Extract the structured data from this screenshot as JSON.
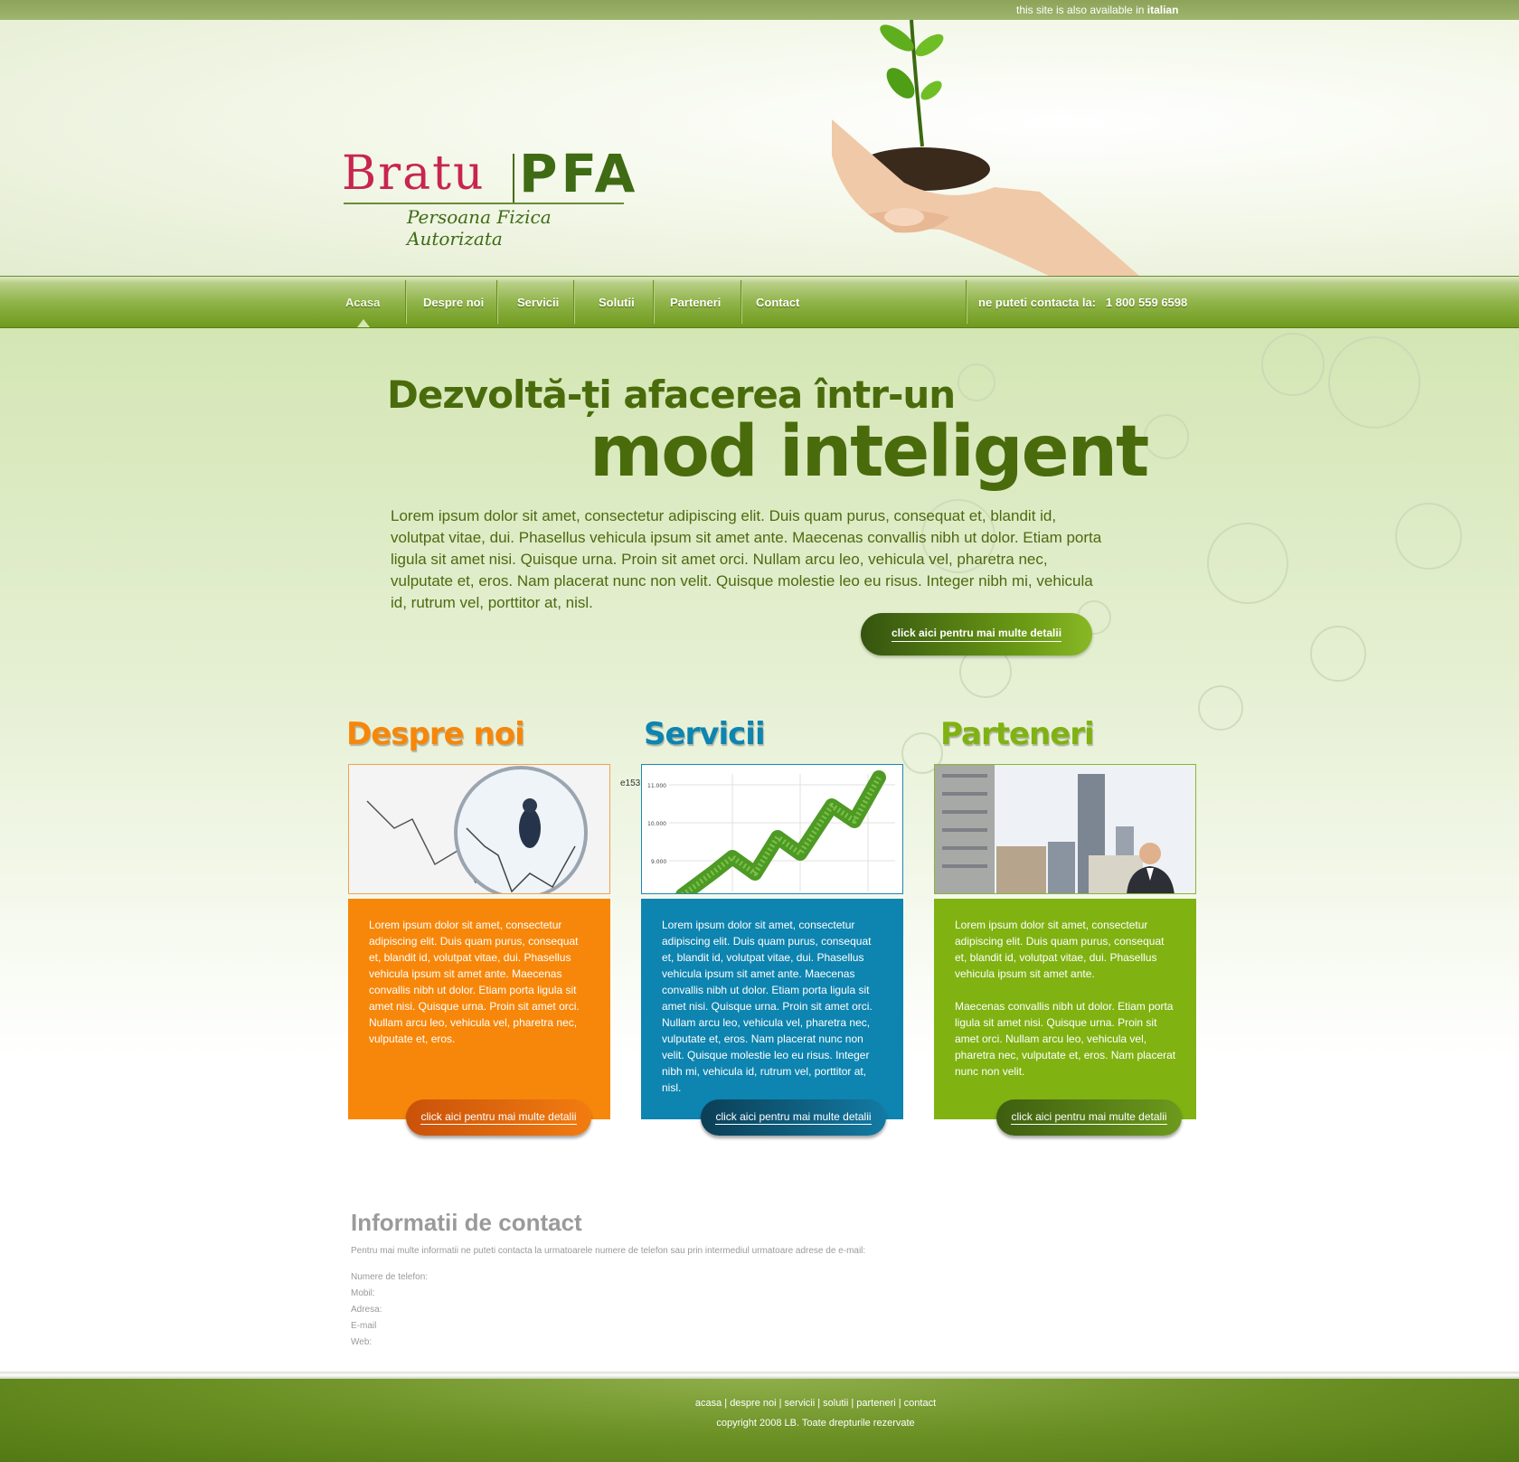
{
  "topbar": {
    "lang_prefix": "this site is also available in",
    "lang_link": "italian"
  },
  "logo": {
    "name": "Bratu",
    "suffix": "PFA",
    "tagline": "Persoana Fizica Autorizata"
  },
  "nav": {
    "items": [
      {
        "label": "Acasa",
        "active": true
      },
      {
        "label": "Despre noi"
      },
      {
        "label": "Servicii"
      },
      {
        "label": "Solutii"
      },
      {
        "label": "Parteneri"
      },
      {
        "label": "Contact"
      }
    ],
    "contact_label": "ne puteti contacta la:",
    "contact_phone": "1 800 559 6598"
  },
  "hero": {
    "headline_1": "Dezvoltă-ți afacerea într-un",
    "headline_2": "mod inteligent",
    "text": "Lorem ipsum dolor sit amet, consectetur adipiscing elit. Duis quam purus, consequat et, blandit id, volutpat vitae, dui. Phasellus vehicula ipsum sit amet ante. Maecenas convallis nibh ut dolor. Etiam porta ligula sit amet nisi. Quisque urna. Proin sit amet orci. Nullam arcu leo, vehicula vel, pharetra nec, vulputate et, eros. Nam placerat nunc non velit. Quisque molestie leo eu risus. Integer nibh mi, vehicula id, rutrum vel, porttitor at, nisl.",
    "button": "click aici pentru mai multe detalii"
  },
  "columns": [
    {
      "title": "Despre noi",
      "color": "#f7870a",
      "paragraphs": [
        "Lorem ipsum dolor sit amet, consectetur adipiscing elit. Duis quam purus, consequat et, blandit id, volutpat vitae, dui. Phasellus vehicula ipsum sit amet ante. Maecenas convallis nibh ut dolor. Etiam porta ligula sit amet nisi. Quisque urna. Proin sit amet orci. Nullam arcu leo, vehicula vel, pharetra nec, vulputate et, eros."
      ],
      "button": "click aici pentru mai multe detalii"
    },
    {
      "title": "Servicii",
      "color": "#0e84b0",
      "paragraphs": [
        "Lorem ipsum dolor sit amet, consectetur adipiscing elit. Duis quam purus, consequat et, blandit id, volutpat vitae, dui. Phasellus vehicula ipsum sit amet ante. Maecenas convallis nibh ut dolor. Etiam porta ligula sit amet nisi. Quisque urna. Proin sit amet orci. Nullam arcu leo, vehicula vel, pharetra nec, vulputate et, eros. Nam placerat nunc non velit. Quisque molestie leo eu risus. Integer nibh mi, vehicula id, rutrum vel, porttitor at, nisl."
      ],
      "button": "click aici pentru mai multe detalii",
      "chart_ticks": [
        "11.000",
        "10.000",
        "9.000"
      ]
    },
    {
      "title": "Parteneri",
      "color": "#80b212",
      "paragraphs": [
        "Lorem ipsum dolor sit amet, consectetur adipiscing elit. Duis quam purus, consequat et, blandit id, volutpat vitae, dui. Phasellus vehicula ipsum sit amet ante.",
        "Maecenas convallis nibh ut dolor. Etiam porta ligula sit amet nisi. Quisque urna. Proin sit amet orci. Nullam arcu leo, vehicula vel, pharetra nec, vulputate et, eros. Nam placerat nunc non velit."
      ],
      "button": "click aici pentru mai multe detalii"
    }
  ],
  "stray_text": "e153",
  "contact": {
    "title": "Informatii de contact",
    "intro": "Pentru mai multe informatii ne puteti contacta la urmatoarele numere de telefon sau prin intermediul urmatoare adrese de e-mail:",
    "fields": [
      "Numere de telefon:",
      "Mobil:",
      "Adresa:",
      "E-mail",
      "Web:"
    ]
  },
  "footer": {
    "links": [
      "acasa",
      "despre noi",
      "servicii",
      "solutii",
      "parteneri",
      "contact"
    ],
    "copyright": "copyright 2008 LB. Toate drepturile rezervate"
  }
}
